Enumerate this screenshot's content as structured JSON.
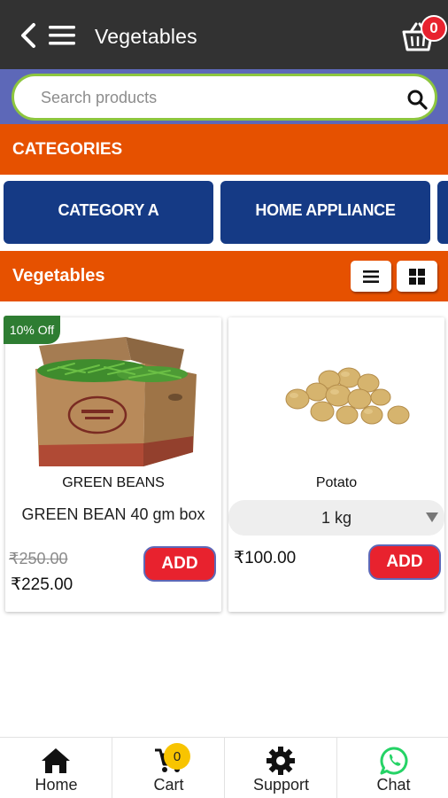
{
  "header": {
    "title": "Vegetables",
    "cart_count": "0",
    "back_icon": "chevron-left-icon",
    "menu_icon": "hamburger-menu-icon",
    "cart_icon": "basket-icon"
  },
  "search": {
    "placeholder": "Search products",
    "value": ""
  },
  "categories": {
    "label": "CATEGORIES",
    "items": [
      {
        "label": "CATEGORY A"
      },
      {
        "label": "HOME APPLIANCE"
      },
      {
        "label": ""
      }
    ]
  },
  "section": {
    "title": "Vegetables",
    "list_view_icon": "list-view-icon",
    "grid_view_icon": "grid-view-icon"
  },
  "products": [
    {
      "discount": "10% Off",
      "name": "GREEN BEANS",
      "description": "GREEN BEAN 40 gm box",
      "old_price": "₹250.00",
      "price": "₹225.00",
      "add_label": "ADD",
      "image": "green-beans-box-image"
    },
    {
      "name": "Potato",
      "variant": "1 kg",
      "price": "₹100.00",
      "add_label": "ADD",
      "image": "potatoes-image"
    }
  ],
  "bottom_nav": [
    {
      "label": "Home",
      "icon": "home-icon"
    },
    {
      "label": "Cart",
      "icon": "cart-icon",
      "badge": "0"
    },
    {
      "label": "Support",
      "icon": "gear-icon"
    },
    {
      "label": "Chat",
      "icon": "whatsapp-icon"
    }
  ],
  "colors": {
    "header_bg": "#323232",
    "search_band": "#5d68b8",
    "search_border": "#8dc63f",
    "orange": "#e65100",
    "category_blue": "#153a85",
    "add_red": "#e8222e",
    "discount_green": "#2e7d32",
    "whatsapp_green": "#25d366",
    "cart_badge_yellow": "#f8c400"
  }
}
